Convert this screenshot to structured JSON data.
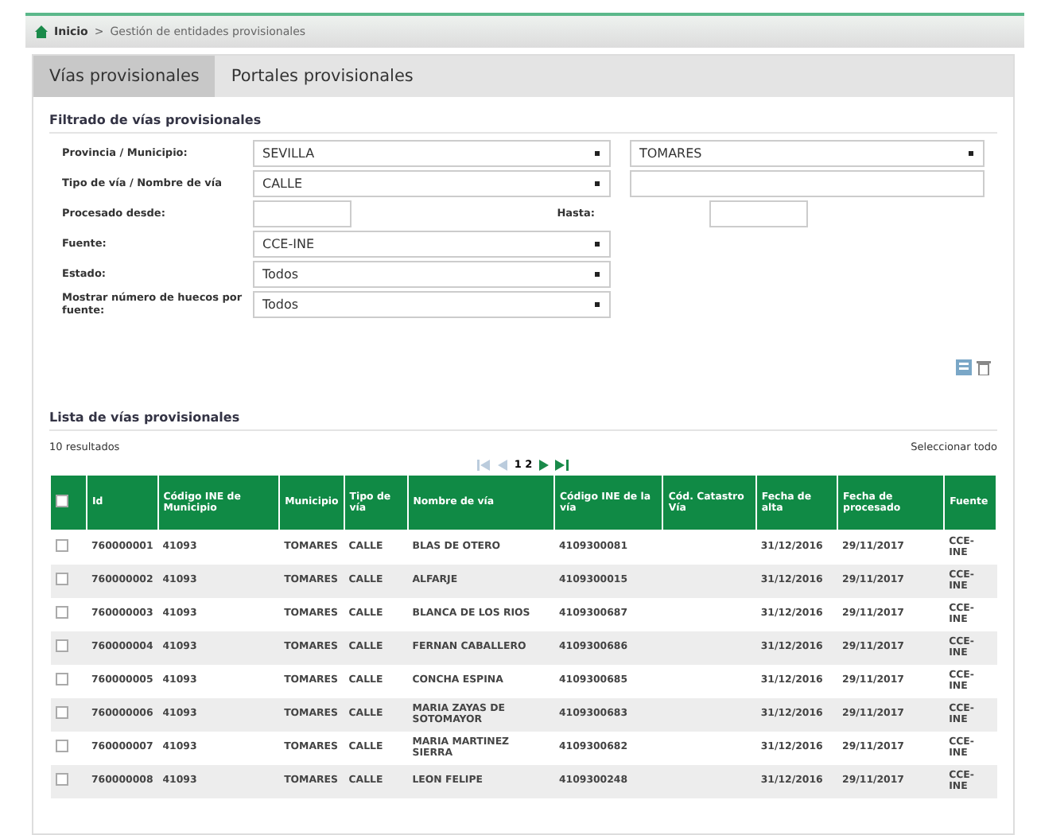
{
  "breadcrumb": {
    "home": "Inicio",
    "separator": ">",
    "current": "Gestión de entidades provisionales"
  },
  "tabs": [
    {
      "label": "Vías provisionales",
      "selected": true
    },
    {
      "label": "Portales provisionales",
      "selected": false
    }
  ],
  "filter": {
    "title": "Filtrado de vías provisionales",
    "province_label": "Provincia / Municipio:",
    "province": "SEVILLA",
    "municipality": "TOMARES",
    "street_type_label": "Tipo de vía / Nombre de vía",
    "street_type": "CALLE",
    "from_label": "Procesado desde:",
    "to_label": "Hasta:",
    "source_label": "Fuente:",
    "source": "CCE-INE",
    "state_label": "Estado:",
    "state": "Todos",
    "show_label": "Mostrar número de huecos por fuente:",
    "show": "Todos"
  },
  "list": {
    "title": "Lista de vías provisionales",
    "count": "10 resultados",
    "select_all": "Seleccionar todo",
    "pages": "1 2",
    "pager": [
      {
        "kind": "first",
        "disabled": true
      },
      {
        "kind": "prev",
        "disabled": true
      },
      {
        "kind": "pages"
      },
      {
        "kind": "next",
        "disabled": false
      },
      {
        "kind": "last",
        "disabled": false
      }
    ]
  },
  "table": {
    "select_all_checked": false,
    "columns": [
      "Id",
      "Código INE de Municipio",
      "Municipio",
      "Tipo de vía",
      "Nombre de vía",
      "Código INE de la vía",
      "Cód. Catastro Vía",
      "Fecha de alta",
      "Fecha de procesado",
      "Fuente"
    ],
    "rows": [
      {
        "checked": false,
        "cells": [
          "760000001",
          "41093",
          "TOMARES",
          "CALLE",
          "BLAS DE OTERO",
          "4109300081",
          "",
          "31/12/2016",
          "29/11/2017",
          "CCE-INE"
        ]
      },
      {
        "checked": false,
        "cells": [
          "760000002",
          "41093",
          "TOMARES",
          "CALLE",
          "ALFARJE",
          "4109300015",
          "",
          "31/12/2016",
          "29/11/2017",
          "CCE-INE"
        ]
      },
      {
        "checked": false,
        "cells": [
          "760000003",
          "41093",
          "TOMARES",
          "CALLE",
          "BLANCA DE LOS RIOS",
          "4109300687",
          "",
          "31/12/2016",
          "29/11/2017",
          "CCE-INE"
        ]
      },
      {
        "checked": false,
        "cells": [
          "760000004",
          "41093",
          "TOMARES",
          "CALLE",
          "FERNAN CABALLERO",
          "4109300686",
          "",
          "31/12/2016",
          "29/11/2017",
          "CCE-INE"
        ]
      },
      {
        "checked": false,
        "cells": [
          "760000005",
          "41093",
          "TOMARES",
          "CALLE",
          "CONCHA ESPINA",
          "4109300685",
          "",
          "31/12/2016",
          "29/11/2017",
          "CCE-INE"
        ]
      },
      {
        "checked": false,
        "cells": [
          "760000006",
          "41093",
          "TOMARES",
          "CALLE",
          "MARIA ZAYAS DE SOTOMAYOR",
          "4109300683",
          "",
          "31/12/2016",
          "29/11/2017",
          "CCE-INE"
        ]
      },
      {
        "checked": false,
        "cells": [
          "760000007",
          "41093",
          "TOMARES",
          "CALLE",
          "MARIA MARTINEZ SIERRA",
          "4109300682",
          "",
          "31/12/2016",
          "29/11/2017",
          "CCE-INE"
        ]
      },
      {
        "checked": false,
        "cells": [
          "760000008",
          "41093",
          "TOMARES",
          "CALLE",
          "LEON FELIPE",
          "4109300248",
          "",
          "31/12/2016",
          "29/11/2017",
          "CCE-INE"
        ]
      }
    ]
  }
}
